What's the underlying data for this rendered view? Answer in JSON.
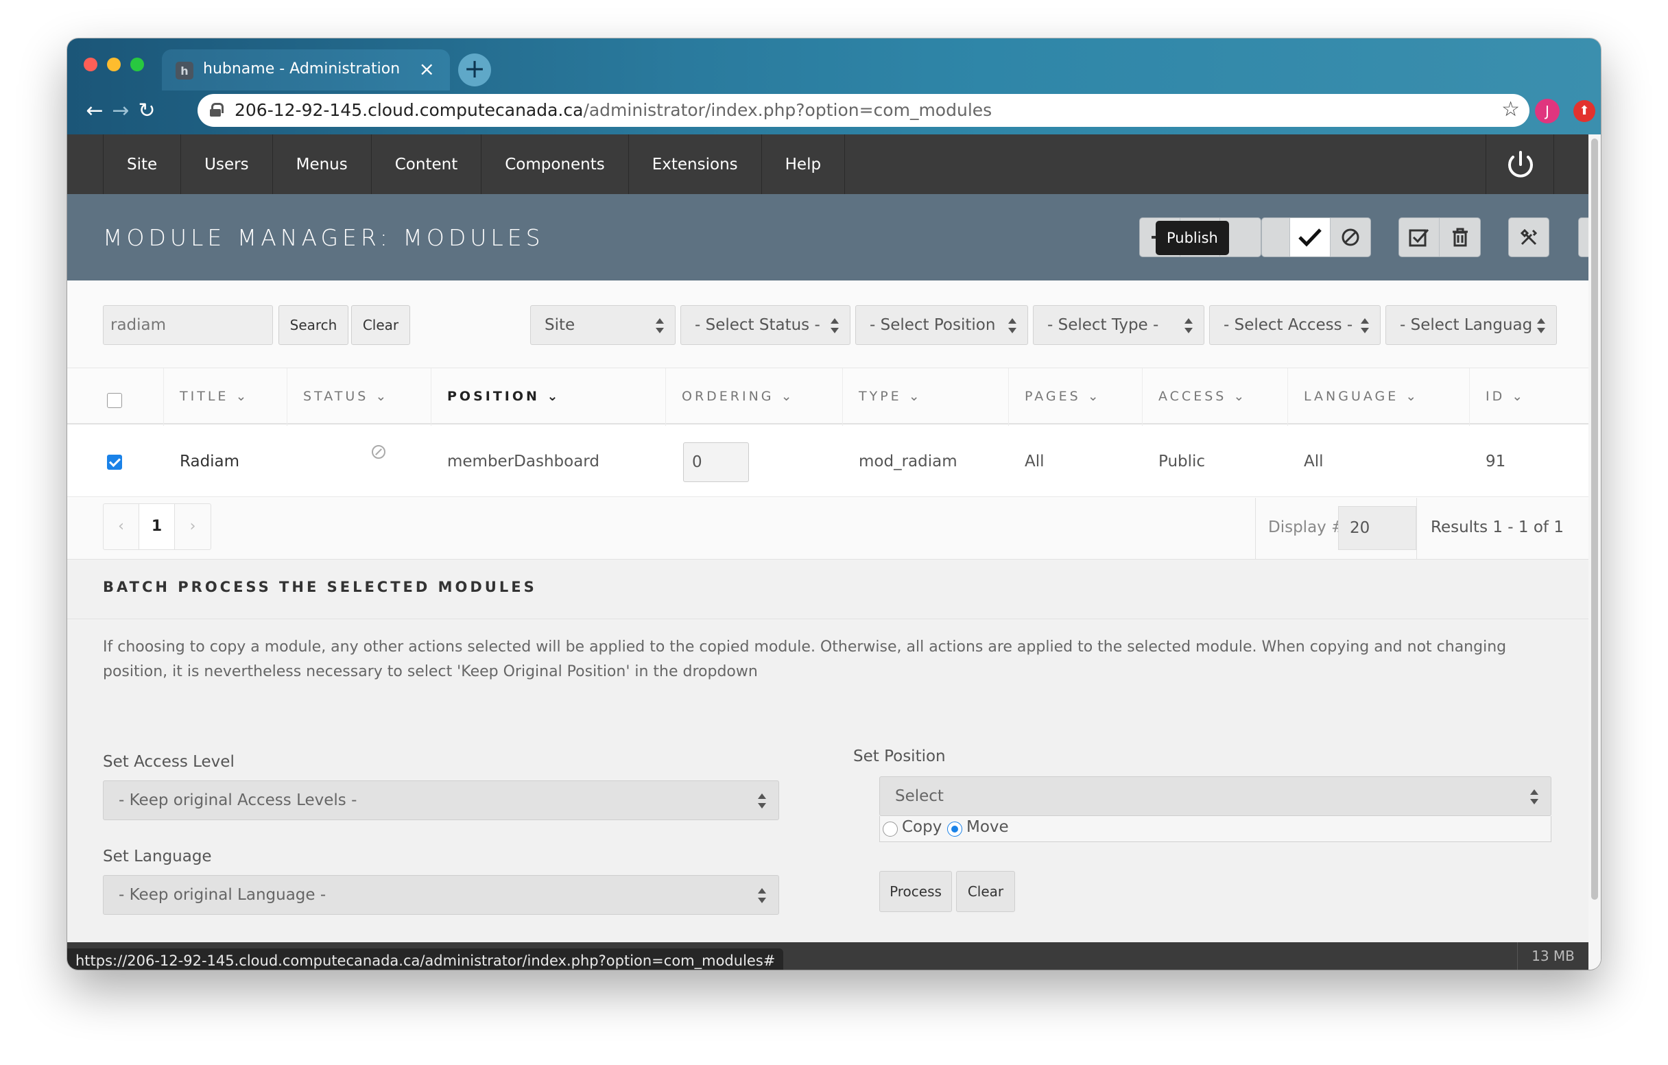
{
  "browser": {
    "tab_title": "hubname - Administration",
    "tab_favicon": "h",
    "url_host": "206-12-92-145.cloud.computecanada.ca",
    "url_path": "/administrator/index.php?option=com_modules",
    "profile_initial": "J",
    "status_url": "https://206-12-92-145.cloud.computecanada.ca/administrator/index.php?option=com_modules#"
  },
  "nav": {
    "items": [
      "Site",
      "Users",
      "Menus",
      "Content",
      "Components",
      "Extensions",
      "Help"
    ]
  },
  "header": {
    "title": "MODULE MANAGER: MODULES",
    "tooltip": "Publish"
  },
  "filters": {
    "search_value": "radiam",
    "search_button": "Search",
    "clear_button": "Clear",
    "site": "Site",
    "status": "- Select Status -",
    "position": "- Select Position",
    "type": "- Select Type -",
    "access": "- Select Access -",
    "language": "- Select Languag"
  },
  "table": {
    "headers": {
      "title": "TITLE",
      "status": "STATUS",
      "position": "POSITION",
      "ordering": "ORDERING",
      "type": "TYPE",
      "pages": "PAGES",
      "access": "ACCESS",
      "language": "LANGUAGE",
      "id": "ID"
    },
    "rows": [
      {
        "selected": true,
        "title": "Radiam",
        "status": "unpublished",
        "position": "memberDashboard",
        "ordering": "0",
        "type": "mod_radiam",
        "pages": "All",
        "access": "Public",
        "language": "All",
        "id": "91"
      }
    ]
  },
  "pagination": {
    "prev": "‹",
    "current": "1",
    "next": "›",
    "display_label": "Display #",
    "display_value": "20",
    "results": "Results 1 - 1 of 1"
  },
  "batch": {
    "title": "BATCH PROCESS THE SELECTED MODULES",
    "description": "If choosing to copy a module, any other actions selected will be applied to the copied module. Otherwise, all actions are applied to the selected module. When copying and not changing position, it is nevertheless necessary to select 'Keep Original Position' in the dropdown",
    "access_label": "Set Access Level",
    "access_value": "- Keep original Access Levels -",
    "language_label": "Set Language",
    "language_value": "- Keep original Language -",
    "position_label": "Set Position",
    "position_value": "Select",
    "copy_label": "Copy",
    "move_label": "Move",
    "move_selected": true,
    "process_button": "Process",
    "clear_button": "Clear"
  },
  "footer": {
    "memory": "13 MB"
  },
  "colors": {
    "nav_bg": "#3b3b3b",
    "header_bg": "#5e7282",
    "checkbox_accent": "#1a82e8"
  }
}
